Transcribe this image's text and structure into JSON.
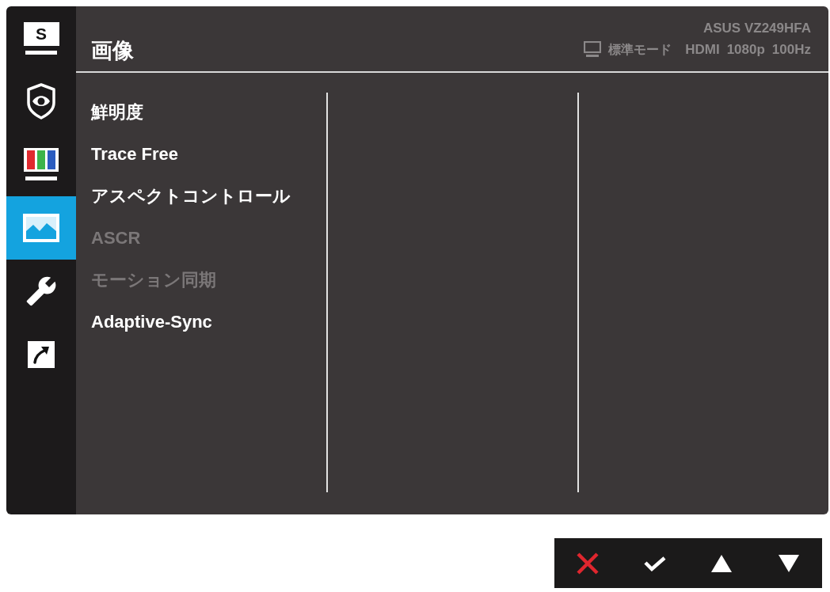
{
  "sidebar": {
    "items": [
      {
        "kind": "letter",
        "label": "S",
        "selected": false
      },
      {
        "kind": "eye",
        "selected": false
      },
      {
        "kind": "color",
        "selected": false
      },
      {
        "kind": "image",
        "selected": true
      },
      {
        "kind": "wrench",
        "selected": false
      },
      {
        "kind": "shortcut",
        "selected": false
      }
    ]
  },
  "header": {
    "title": "画像",
    "model": "ASUS VZ249HFA",
    "status": {
      "mode": "標準モード",
      "input": "HDMI",
      "resolution": "1080p",
      "refresh_rate": "100Hz"
    }
  },
  "menu": {
    "items": [
      {
        "label": "鮮明度",
        "disabled": false
      },
      {
        "label": "Trace Free",
        "disabled": false
      },
      {
        "label": "アスペクトコントロール",
        "disabled": false
      },
      {
        "label": "ASCR",
        "disabled": true
      },
      {
        "label": "モーション同期",
        "disabled": true
      },
      {
        "label": "Adaptive-Sync",
        "disabled": false
      }
    ]
  },
  "buttons": [
    {
      "kind": "close"
    },
    {
      "kind": "confirm"
    },
    {
      "kind": "up"
    },
    {
      "kind": "down"
    }
  ]
}
